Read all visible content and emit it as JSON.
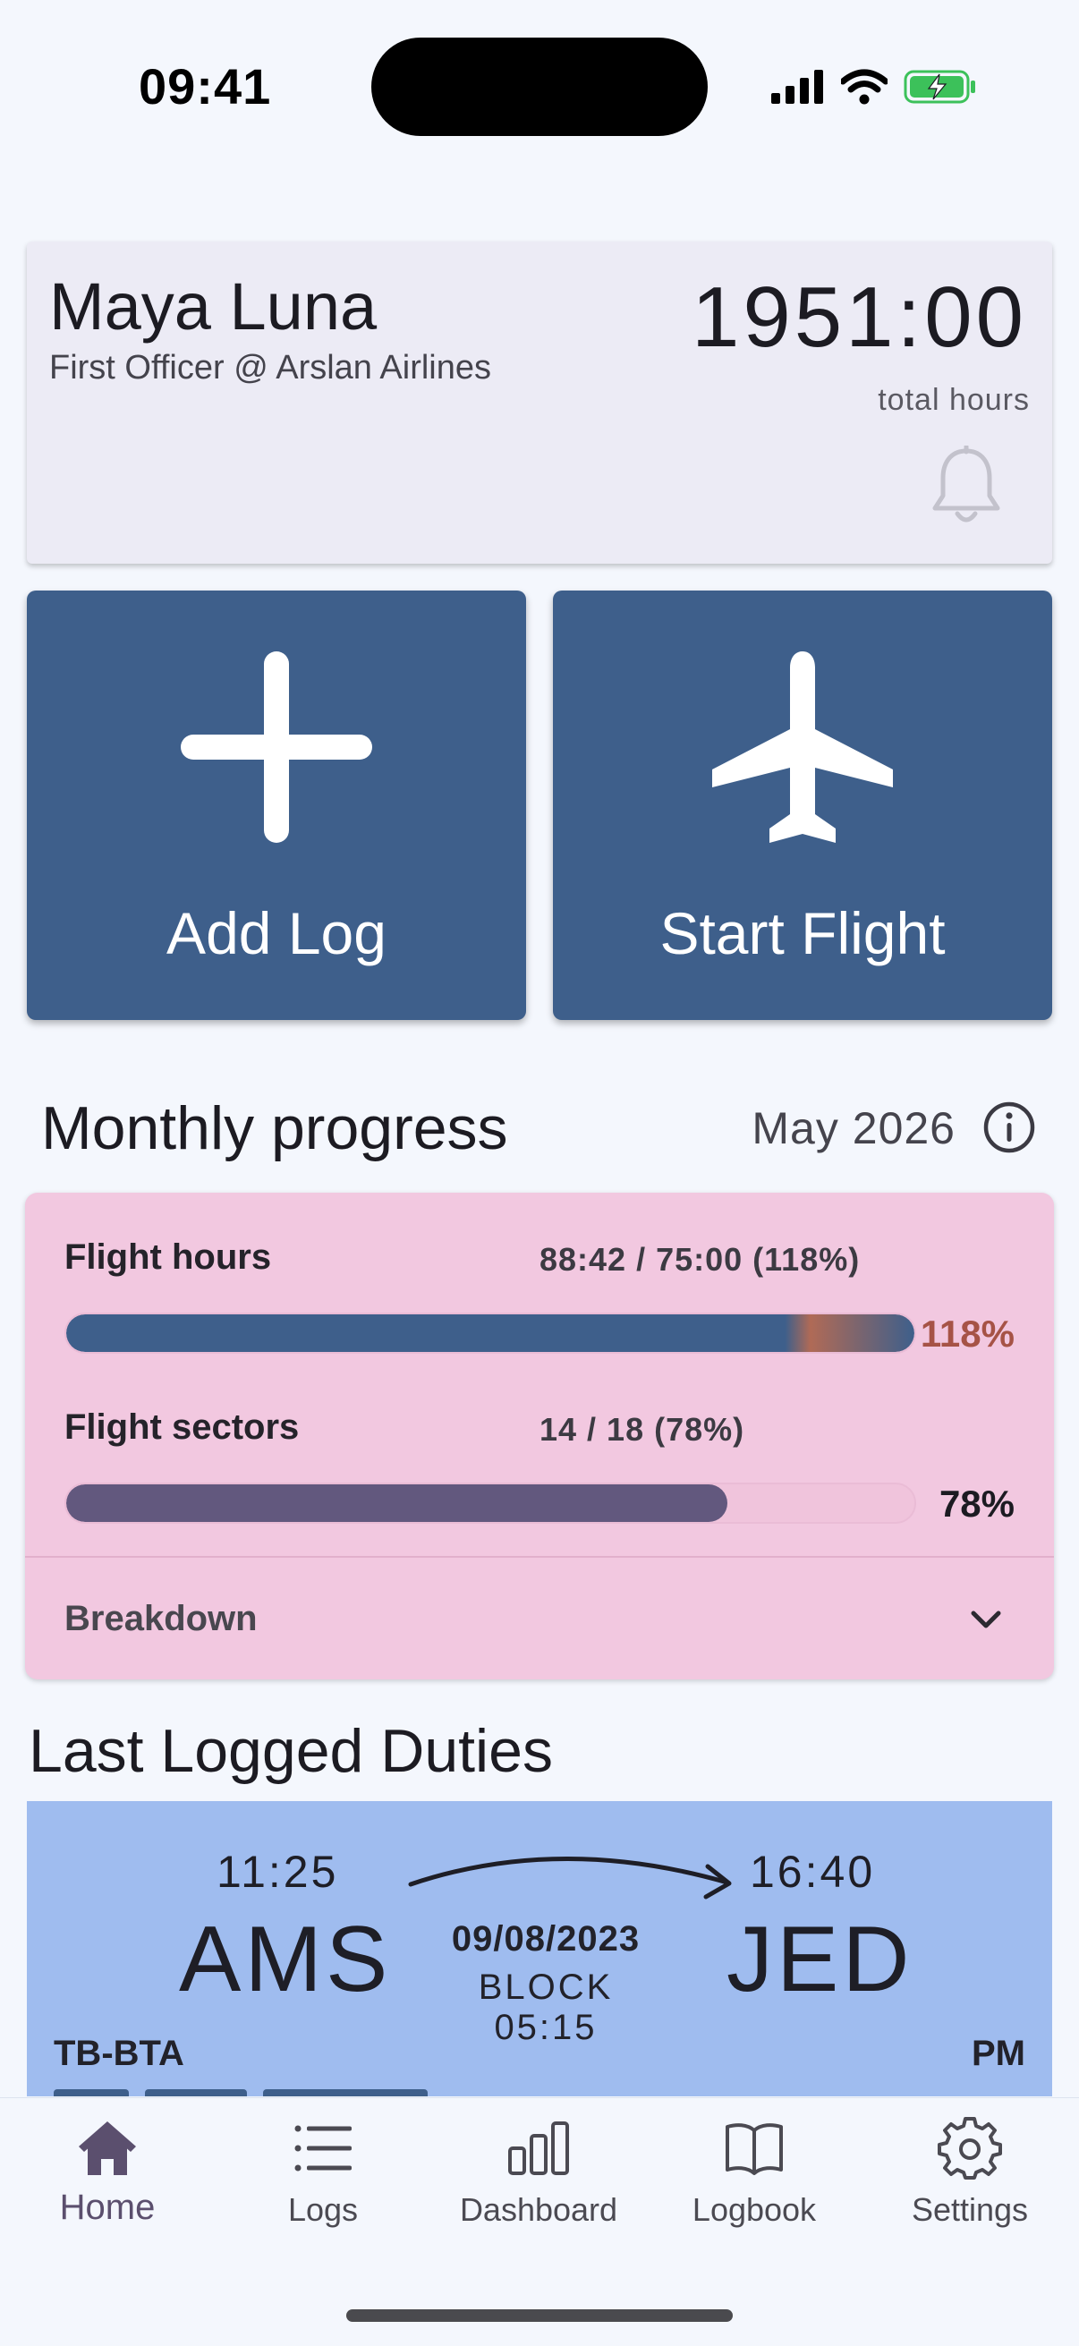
{
  "status_bar": {
    "time": "09:41",
    "icons": [
      "signal-icon",
      "wifi-icon",
      "battery-charging-icon"
    ]
  },
  "profile": {
    "name": "Maya Luna",
    "role": "First Officer @ Arslan Airlines",
    "total_hours": "1951:00",
    "total_hours_label": "total hours",
    "notification_icon": "bell-icon"
  },
  "actions": {
    "add_log": {
      "label": "Add Log",
      "icon": "plus-icon"
    },
    "start_flight": {
      "label": "Start Flight",
      "icon": "airplane-icon"
    }
  },
  "monthly_progress": {
    "title": "Monthly progress",
    "month": "May 2026",
    "info_icon": "info-icon",
    "metrics": [
      {
        "label": "Flight hours",
        "value": "88:42 / 75:00 (118%)",
        "percent_text": "118%",
        "fraction": 1.18,
        "color": "#3e5f8b",
        "overflow_color": "#b06a56",
        "pct_color": "#a65346"
      },
      {
        "label": "Flight sectors",
        "value": "14 / 18 (78%)",
        "percent_text": "78%",
        "fraction": 0.78,
        "color": "#62587e",
        "pct_color": "#1c1b22"
      }
    ],
    "breakdown_label": "Breakdown"
  },
  "last_duties": {
    "title": "Last Logged Duties",
    "duty": {
      "dep_time": "11:25",
      "arr_time": "16:40",
      "dep": "AMS",
      "arr": "JED",
      "date": "09/08/2023",
      "block": "BLOCK 05:15",
      "registration": "TB-BTA",
      "period": "PM"
    }
  },
  "nav": {
    "items": [
      {
        "label": "Home",
        "icon": "home-icon",
        "active": true
      },
      {
        "label": "Logs",
        "icon": "list-icon",
        "active": false
      },
      {
        "label": "Dashboard",
        "icon": "bar-chart-icon",
        "active": false
      },
      {
        "label": "Logbook",
        "icon": "book-icon",
        "active": false
      },
      {
        "label": "Settings",
        "icon": "gear-icon",
        "active": false
      }
    ]
  },
  "colors": {
    "primary": "#3e5f8b",
    "progress_card": "#f2c8e0",
    "duty_card": "#9fbcef",
    "profile_card": "#ecebf5",
    "background": "#f4f7fd"
  }
}
